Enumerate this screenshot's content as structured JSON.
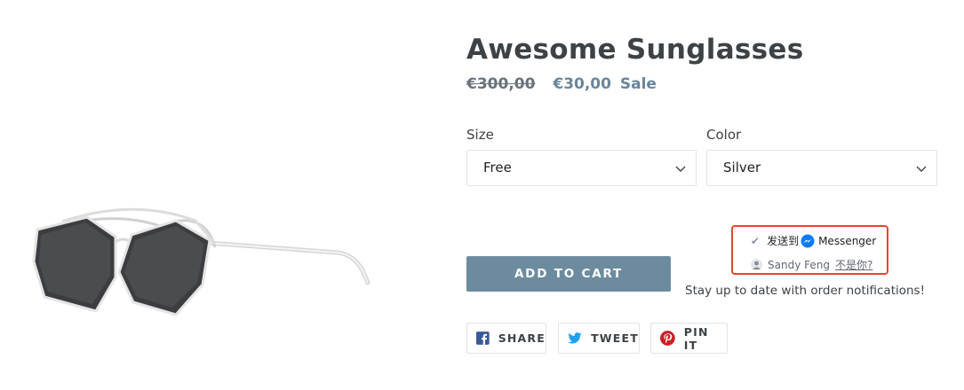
{
  "product": {
    "title": "Awesome Sunglasses",
    "price_original": "€300,00",
    "price_sale": "€30,00",
    "sale_badge": "Sale"
  },
  "options": {
    "size": {
      "label": "Size",
      "selected": "Free"
    },
    "color": {
      "label": "Color",
      "selected": "Silver"
    }
  },
  "messenger_plugin": {
    "send_to": "发送到",
    "messenger": "Messenger",
    "user_name": "Sandy Feng",
    "not_you": "不是你?",
    "accent": "#e94526"
  },
  "notification_text": "Stay up to date with order notifications!",
  "cart": {
    "add_label": "ADD TO CART",
    "color": "#6d8b9e"
  },
  "share": {
    "facebook": "SHARE",
    "twitter": "TWEET",
    "pinterest": "PIN IT"
  },
  "icons": {
    "facebook": "facebook-icon",
    "twitter": "twitter-icon",
    "pinterest": "pinterest-icon",
    "messenger": "messenger-icon",
    "chevron": "chevron-down-icon"
  }
}
